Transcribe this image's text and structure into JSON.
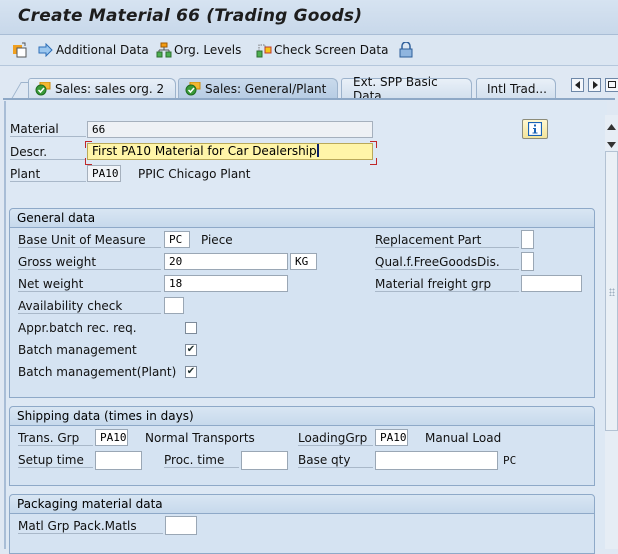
{
  "window": {
    "title": "Create Material 66 (Trading Goods)"
  },
  "toolbar": {
    "items": [
      {
        "label": "",
        "icon": "new-session-icon"
      },
      {
        "label": "Additional Data",
        "icon": "arrow-right-icon"
      },
      {
        "label": "Org. Levels",
        "icon": "org-hierarchy-icon"
      },
      {
        "label": "Check Screen Data",
        "icon": "check-data-icon"
      },
      {
        "label": "",
        "icon": "lock-icon"
      }
    ]
  },
  "tabs": [
    {
      "label": "Sales: sales org. 2",
      "status_icon": "checkmark-icon",
      "active": false
    },
    {
      "label": "Sales: General/Plant",
      "status_icon": "checkmark-icon",
      "active": true
    },
    {
      "label": "Ext. SPP Basic Data",
      "active": false
    },
    {
      "label": "Intl Trad...",
      "active": false
    }
  ],
  "header": {
    "material_label": "Material",
    "material_value": "66",
    "descr_label": "Descr.",
    "descr_value": "First PA10 Material for Car Dealership",
    "plant_label": "Plant",
    "plant_value": "PA10",
    "plant_name": "PPIC Chicago Plant"
  },
  "general_data": {
    "title": "General data",
    "base_uom_label": "Base Unit of Measure",
    "base_uom_value": "PC",
    "base_uom_text": "Piece",
    "gross_weight_label": "Gross weight",
    "gross_weight_value": "20",
    "weight_unit": "KG",
    "net_weight_label": "Net weight",
    "net_weight_value": "18",
    "availability_check_label": "Availability check",
    "availability_check_value": "",
    "appr_batch_label": "Appr.batch rec. req.",
    "appr_batch_checked": false,
    "batch_mgmt_label": "Batch management",
    "batch_mgmt_checked": true,
    "batch_mgmt_plant_label": "Batch management(Plant)",
    "batch_mgmt_plant_checked": true,
    "replacement_part_label": "Replacement Part",
    "replacement_part_value": "",
    "free_goods_label": "Qual.f.FreeGoodsDis.",
    "free_goods_value": "",
    "freight_grp_label": "Material freight grp",
    "freight_grp_value": ""
  },
  "shipping_data": {
    "title": "Shipping data (times in days)",
    "trans_grp_label": "Trans. Grp",
    "trans_grp_value": "PA10",
    "trans_grp_text": "Normal Transports",
    "loading_grp_label": "LoadingGrp",
    "loading_grp_value": "PA10",
    "loading_grp_text": "Manual Load",
    "setup_time_label": "Setup time",
    "setup_time_value": "",
    "proc_time_label": "Proc. time",
    "proc_time_value": "",
    "base_qty_label": "Base qty",
    "base_qty_value": "",
    "base_qty_unit": "PC"
  },
  "packaging_data": {
    "title": "Packaging material data",
    "matl_grp_label": "Matl Grp Pack.Matls",
    "matl_grp_value": ""
  }
}
